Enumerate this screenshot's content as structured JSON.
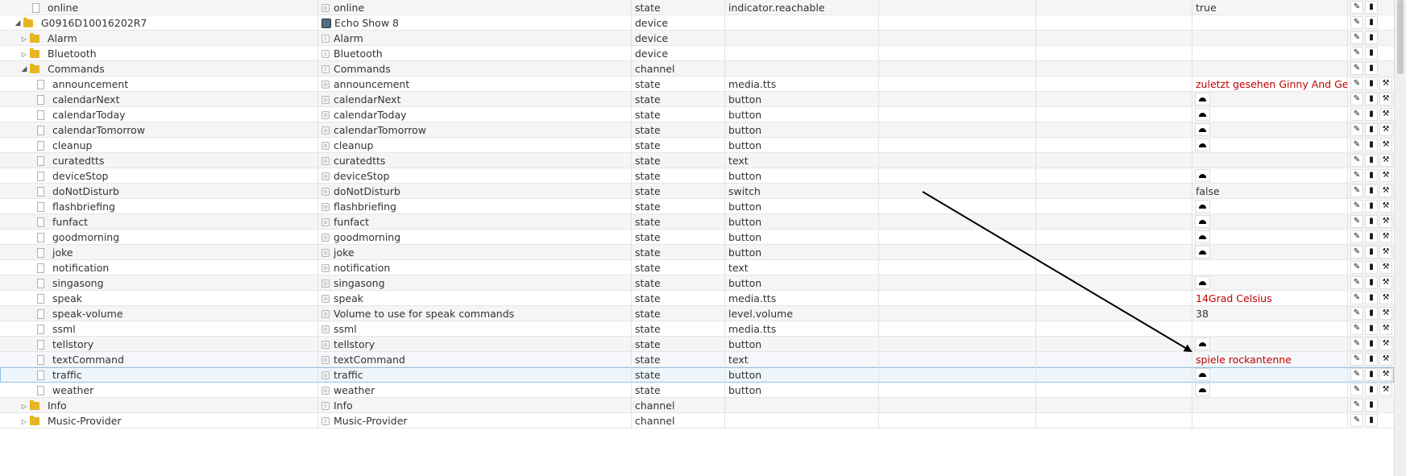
{
  "rows": [
    {
      "name": "online",
      "title": "online",
      "role": "state",
      "type": "indicator.reachable",
      "value": "true",
      "value_kind": "plain",
      "actions": 2,
      "icon": "file",
      "title_icon": "state",
      "indent": 40,
      "alt": true
    },
    {
      "name": "G0916D10016202R7",
      "title": "Echo Show 8",
      "role": "device",
      "type": "",
      "value": "",
      "value_kind": "none",
      "actions": 2,
      "icon": "folder",
      "title_icon": "device",
      "indent": 18,
      "toggle": "open"
    },
    {
      "name": "Alarm",
      "title": "Alarm",
      "role": "device",
      "type": "",
      "value": "",
      "value_kind": "none",
      "actions": 2,
      "icon": "folder",
      "title_icon": "channel",
      "indent": 26,
      "toggle": "closed",
      "alt": true
    },
    {
      "name": "Bluetooth",
      "title": "Bluetooth",
      "role": "device",
      "type": "",
      "value": "",
      "value_kind": "none",
      "actions": 2,
      "icon": "folder",
      "title_icon": "channel",
      "indent": 26,
      "toggle": "closed"
    },
    {
      "name": "Commands",
      "title": "Commands",
      "role": "channel",
      "type": "",
      "value": "",
      "value_kind": "none",
      "actions": 2,
      "icon": "folder",
      "title_icon": "channel",
      "indent": 26,
      "toggle": "open",
      "alt": true
    },
    {
      "name": "announcement",
      "title": "announcement",
      "role": "state",
      "type": "media.tts",
      "value": "zuletzt gesehen Ginny And Georgia die",
      "value_kind": "red",
      "actions": 3,
      "icon": "file",
      "title_icon": "state",
      "indent": 46
    },
    {
      "name": "calendarNext",
      "title": "calendarNext",
      "role": "state",
      "type": "button",
      "value": "",
      "value_kind": "button",
      "actions": 3,
      "icon": "file",
      "title_icon": "state",
      "indent": 46,
      "alt": true
    },
    {
      "name": "calendarToday",
      "title": "calendarToday",
      "role": "state",
      "type": "button",
      "value": "",
      "value_kind": "button",
      "actions": 3,
      "icon": "file",
      "title_icon": "state",
      "indent": 46
    },
    {
      "name": "calendarTomorrow",
      "title": "calendarTomorrow",
      "role": "state",
      "type": "button",
      "value": "",
      "value_kind": "button",
      "actions": 3,
      "icon": "file",
      "title_icon": "state",
      "indent": 46,
      "alt": true
    },
    {
      "name": "cleanup",
      "title": "cleanup",
      "role": "state",
      "type": "button",
      "value": "",
      "value_kind": "button",
      "actions": 3,
      "icon": "file",
      "title_icon": "state",
      "indent": 46
    },
    {
      "name": "curatedtts",
      "title": "curatedtts",
      "role": "state",
      "type": "text",
      "value": "",
      "value_kind": "none",
      "actions": 3,
      "icon": "file",
      "title_icon": "state",
      "indent": 46,
      "alt": true
    },
    {
      "name": "deviceStop",
      "title": "deviceStop",
      "role": "state",
      "type": "button",
      "value": "",
      "value_kind": "button",
      "actions": 3,
      "icon": "file",
      "title_icon": "state",
      "indent": 46
    },
    {
      "name": "doNotDisturb",
      "title": "doNotDisturb",
      "role": "state",
      "type": "switch",
      "value": "false",
      "value_kind": "plain",
      "actions": 3,
      "icon": "file",
      "title_icon": "state",
      "indent": 46,
      "alt": true
    },
    {
      "name": "flashbriefing",
      "title": "flashbriefing",
      "role": "state",
      "type": "button",
      "value": "",
      "value_kind": "button",
      "actions": 3,
      "icon": "file",
      "title_icon": "state",
      "indent": 46
    },
    {
      "name": "funfact",
      "title": "funfact",
      "role": "state",
      "type": "button",
      "value": "",
      "value_kind": "button",
      "actions": 3,
      "icon": "file",
      "title_icon": "state",
      "indent": 46,
      "alt": true
    },
    {
      "name": "goodmorning",
      "title": "goodmorning",
      "role": "state",
      "type": "button",
      "value": "",
      "value_kind": "button",
      "actions": 3,
      "icon": "file",
      "title_icon": "state",
      "indent": 46
    },
    {
      "name": "joke",
      "title": "joke",
      "role": "state",
      "type": "button",
      "value": "",
      "value_kind": "button",
      "actions": 3,
      "icon": "file",
      "title_icon": "state",
      "indent": 46,
      "alt": true
    },
    {
      "name": "notification",
      "title": "notification",
      "role": "state",
      "type": "text",
      "value": "",
      "value_kind": "none",
      "actions": 3,
      "icon": "file",
      "title_icon": "state",
      "indent": 46
    },
    {
      "name": "singasong",
      "title": "singasong",
      "role": "state",
      "type": "button",
      "value": "",
      "value_kind": "button",
      "actions": 3,
      "icon": "file",
      "title_icon": "state",
      "indent": 46,
      "alt": true
    },
    {
      "name": "speak",
      "title": "speak",
      "role": "state",
      "type": "media.tts",
      "value": "14Grad Celsius",
      "value_kind": "red",
      "actions": 3,
      "icon": "file",
      "title_icon": "state",
      "indent": 46
    },
    {
      "name": "speak-volume",
      "title": "Volume to use for speak commands",
      "role": "state",
      "type": "level.volume",
      "value": "38",
      "value_kind": "plain",
      "actions": 3,
      "icon": "file",
      "title_icon": "state",
      "indent": 46,
      "alt": true
    },
    {
      "name": "ssml",
      "title": "ssml",
      "role": "state",
      "type": "media.tts",
      "value": "",
      "value_kind": "none",
      "actions": 3,
      "icon": "file",
      "title_icon": "state",
      "indent": 46
    },
    {
      "name": "tellstory",
      "title": "tellstory",
      "role": "state",
      "type": "button",
      "value": "",
      "value_kind": "button",
      "actions": 3,
      "icon": "file",
      "title_icon": "state",
      "indent": 46,
      "alt": true
    },
    {
      "name": "textCommand",
      "title": "textCommand",
      "role": "state",
      "type": "text",
      "value": "spiele rockantenne",
      "value_kind": "red",
      "actions": 3,
      "icon": "file",
      "title_icon": "state",
      "indent": 46,
      "hover": true
    },
    {
      "name": "traffic",
      "title": "traffic",
      "role": "state",
      "type": "button",
      "value": "",
      "value_kind": "button",
      "actions": 3,
      "icon": "file",
      "title_icon": "state",
      "indent": 46,
      "selected": true
    },
    {
      "name": "weather",
      "title": "weather",
      "role": "state",
      "type": "button",
      "value": "",
      "value_kind": "button",
      "actions": 3,
      "icon": "file",
      "title_icon": "state",
      "indent": 46
    },
    {
      "name": "Info",
      "title": "Info",
      "role": "channel",
      "type": "",
      "value": "",
      "value_kind": "none",
      "actions": 2,
      "icon": "folder",
      "title_icon": "channel",
      "indent": 26,
      "toggle": "closed",
      "alt": true
    },
    {
      "name": "Music-Provider",
      "title": "Music-Provider",
      "role": "channel",
      "type": "",
      "value": "",
      "value_kind": "none",
      "actions": 2,
      "icon": "folder",
      "title_icon": "channel",
      "indent": 26,
      "toggle": "closed"
    }
  ],
  "icons": {
    "edit": "pencil-icon",
    "delete": "trash-icon",
    "settings": "wrench-icon",
    "button_value": "button-trigger-icon"
  },
  "colors": {
    "value_red": "#c00000",
    "folder": "#e6b622",
    "selected_border": "#8fc3e8"
  }
}
